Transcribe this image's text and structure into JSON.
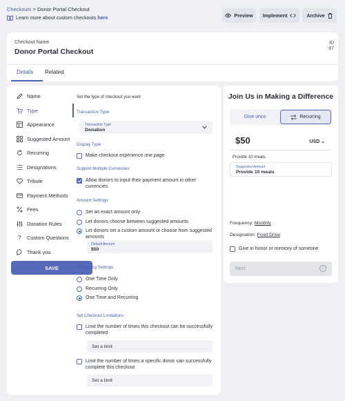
{
  "breadcrumb": {
    "parent": "Checkouts",
    "separator": ">",
    "current": "Donor Portal Checkout"
  },
  "learn": {
    "text": "Learn more about custom checkouts ",
    "link": "here"
  },
  "actions": {
    "preview": "Preview",
    "implement": "Implement",
    "archive": "Archive"
  },
  "checkout": {
    "name_label": "Checkout Name",
    "name": "Donor Portal Checkout",
    "id_label": "ID",
    "id": "87"
  },
  "tabs": [
    {
      "label": "Details",
      "active": true
    },
    {
      "label": "Related",
      "active": false
    }
  ],
  "nav": {
    "items": [
      {
        "label": "Name",
        "icon": "pencil-icon"
      },
      {
        "label": "Type",
        "icon": "cart-icon"
      },
      {
        "label": "Appearance",
        "icon": "layout-icon"
      },
      {
        "label": "Suggested Amount",
        "icon": "grid-icon"
      },
      {
        "label": "Recurring",
        "icon": "refresh-icon"
      },
      {
        "label": "Designations",
        "icon": "list-icon"
      },
      {
        "label": "Tribute",
        "icon": "heart-icon"
      },
      {
        "label": "Payment Methods",
        "icon": "credit-card-icon"
      },
      {
        "label": "Fees",
        "icon": "percent-icon"
      },
      {
        "label": "Donation Rules",
        "icon": "sliders-icon"
      },
      {
        "label": "Custom Questions",
        "icon": "question-icon"
      },
      {
        "label": "Thank you",
        "icon": "chat-icon"
      }
    ],
    "active": "Type",
    "save": "SAVE"
  },
  "form": {
    "intro": "Set the type of checkout you want",
    "transaction_type": {
      "section": "Transaction Type",
      "caption": "Transaction Type",
      "value": "Donation"
    },
    "display_type": {
      "section": "Display Type",
      "option": "Make checkout experience one page",
      "checked": false
    },
    "currencies": {
      "section": "Support Multiple Currencies",
      "option": "Allow donors to input their payment amount in other currencies",
      "checked": true
    },
    "amount": {
      "section": "Amount Settings",
      "options": [
        "Set an exact amount only",
        "Let donors choose between suggested amounts",
        "Let donors set a custom amount or choose from suggested amounts"
      ],
      "selected": 2,
      "default_caption": "Default Amount",
      "default_value": "$50"
    },
    "frequency": {
      "section": "Frequency Settings",
      "options": [
        "One Time Only",
        "Recurring Only",
        "One Time and Recurring"
      ],
      "selected": 2
    },
    "limits": {
      "section": "Set Checkout Limitations",
      "option1": "Limit the number of times this checkout can be successfully completed",
      "option2": "Limit the number of times a specific donor can successfully complete this checkout",
      "placeholder": "Set a limit"
    }
  },
  "preview": {
    "title": "Join Us in Making a Difference",
    "give_once": "Give once",
    "recurring": "Recurring",
    "amount": "$50",
    "currency": "USD",
    "impact": "Provide 10 meals",
    "suggested_caption": "Suggested Amount",
    "suggested_value": "Provide 10 meals",
    "frequency_label": "Frequency: ",
    "frequency_value": "Monthly",
    "designation_label": "Designation: ",
    "designation_value": "Food Drive",
    "tribute": "Give in honor or memory of someone",
    "next": "Next"
  },
  "colors": {
    "accent": "#4a5fb0",
    "button": "#5668b8",
    "background": "#eef0f4"
  }
}
